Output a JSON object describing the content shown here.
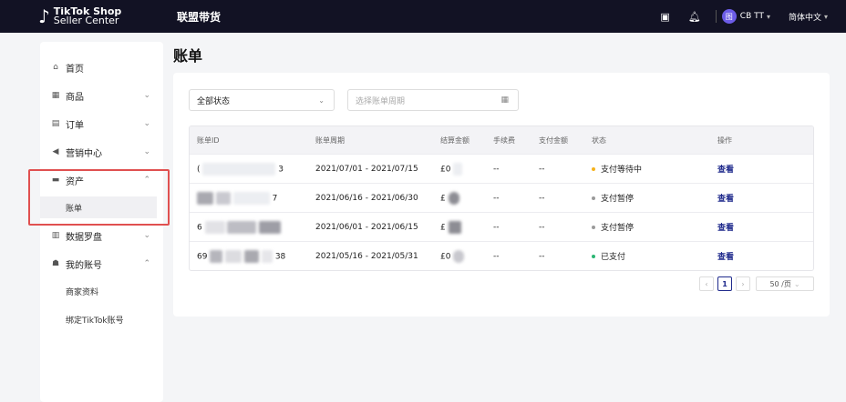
{
  "topbar": {
    "logo_line1": "TikTok Shop",
    "logo_line2": "Seller Center",
    "title": "联盟带货",
    "user": "CB TT",
    "avatar": "图",
    "language": "简体中文",
    "icons": [
      "message-icon",
      "bell-icon",
      "chevron-down-icon"
    ]
  },
  "sidebar": {
    "items": [
      {
        "label": "首页",
        "icon": "home-icon"
      },
      {
        "label": "商品",
        "icon": "product-icon"
      },
      {
        "label": "订单",
        "icon": "order-icon"
      },
      {
        "label": "营销中心",
        "icon": "megaphone-icon"
      },
      {
        "label": "资产",
        "icon": "wallet-icon"
      },
      {
        "label": "账单",
        "icon": ""
      },
      {
        "label": "数据罗盘",
        "icon": "chart-icon"
      },
      {
        "label": "我的账号",
        "icon": "user-icon"
      },
      {
        "label": "商家资料",
        "icon": ""
      },
      {
        "label": "绑定TikTok账号",
        "icon": ""
      }
    ]
  },
  "page": {
    "title": "账单"
  },
  "filters": {
    "status_value": "全部状态",
    "date_placeholder": "选择账单周期"
  },
  "table": {
    "headers": [
      "账单ID",
      "账单周期",
      "结算金额",
      "手续费",
      "支付金额",
      "状态",
      "操作"
    ],
    "rows": [
      {
        "id_start": "(",
        "id_end": "3",
        "period": "2021/07/01 - 2021/07/15",
        "amount": "£0",
        "fee": "--",
        "paid": "--",
        "status": "支付等待中",
        "status_color": "#f5b21b",
        "action": "查看"
      },
      {
        "id_start": "",
        "id_end": "7",
        "period": "2021/06/16 - 2021/06/30",
        "amount": "£",
        "fee": "--",
        "paid": "--",
        "status": "支付暂停",
        "status_color": "#9a9a9a",
        "action": "查看"
      },
      {
        "id_start": "6",
        "id_end": "",
        "period": "2021/06/01 - 2021/06/15",
        "amount": "£",
        "fee": "--",
        "paid": "--",
        "status": "支付暂停",
        "status_color": "#9a9a9a",
        "action": "查看"
      },
      {
        "id_start": "69",
        "id_end": "38",
        "period": "2021/05/16 - 2021/05/31",
        "amount": "£0",
        "fee": "--",
        "paid": "--",
        "status": "已支付",
        "status_color": "#2bb673",
        "action": "查看"
      }
    ]
  },
  "pagination": {
    "prev": "‹",
    "current": "1",
    "next": "›",
    "page_size": "50 /页"
  },
  "colors": {
    "topbar": "#121224",
    "link": "#1f2a8c",
    "highlight": "#e05050"
  }
}
